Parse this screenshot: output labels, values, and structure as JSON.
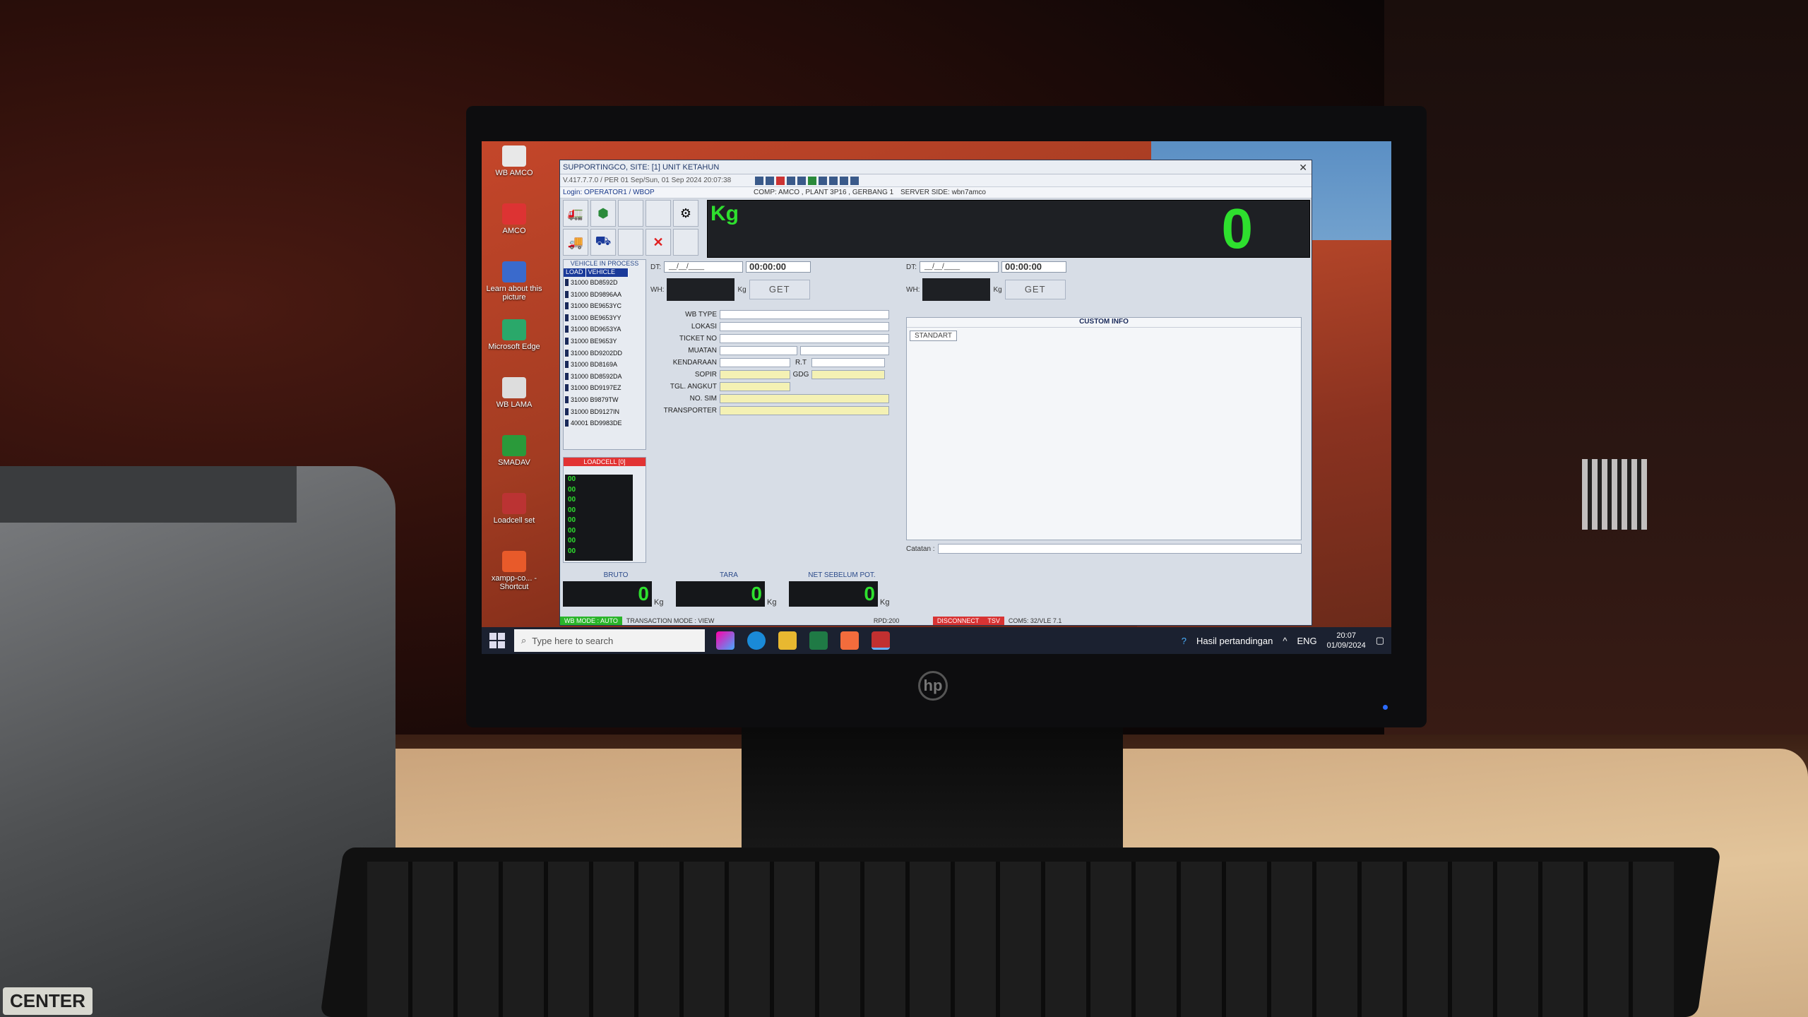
{
  "desktop_icons": [
    {
      "label": "WB AMCO",
      "color": "#e8e8e8"
    },
    {
      "label": "AMCO",
      "color": "#d33"
    },
    {
      "label": "Learn about this picture",
      "color": "#3a6acc"
    },
    {
      "label": "Microsoft Edge",
      "color": "#2aa86a"
    },
    {
      "label": "WB LAMA",
      "color": "#ddd"
    },
    {
      "label": "SMADAV",
      "color": "#2a9a3a"
    },
    {
      "label": "Loadcell set",
      "color": "#b33"
    },
    {
      "label": "xampp-co... - Shortcut",
      "color": "#e85a2a"
    }
  ],
  "window": {
    "title": "SUPPORTINGCO, SITE: [1] UNIT KETAHUN",
    "version": "V.417.7.7.0 / PER 01 Sep/Sun, 01 Sep 2024 20:07:38",
    "login": "Login: OPERATOR1 / WBOP",
    "comp": "COMP: AMCO , PLANT 3P16 , GERBANG 1",
    "server": "SERVER SIDE: wbn7amco"
  },
  "weigh": {
    "unit": "Kg",
    "value": "0"
  },
  "vehicle_panel": {
    "title": "VEHICLE IN PROCESS",
    "col_load": "LOAD",
    "col_vehicle": "VEHICLE",
    "vehicles": [
      "31000 BD8592D",
      "31000 BD9896AA",
      "31000 BE9653YC",
      "31000 BE9653YY",
      "31000 BD9653YA",
      "31000 BE9653Y",
      "31000 BD9202DD",
      "31000 BD8169A",
      "31000 BD8592DA",
      "31000 BD9197EZ",
      "31000 B9879TW",
      "31000 BD9127IN",
      "40001 BD9983DE"
    ]
  },
  "loadcell": {
    "title": "LOADCELL [0]",
    "values": [
      "00",
      "00",
      "00",
      "00",
      "00",
      "00",
      "00",
      "00"
    ]
  },
  "form_left": {
    "dt_label": "DT:",
    "date": "__/__/____",
    "time": "00:00:00",
    "wh_label": "WH:",
    "kg": "Kg",
    "get": "GET",
    "fields": [
      "WB TYPE",
      "LOKASI",
      "TICKET NO",
      "MUATAN",
      "KENDARAAN",
      "SOPIR",
      "TGL. ANGKUT",
      "NO. SIM",
      "TRANSPORTER"
    ],
    "rt": "R.T",
    "gdg": "GDG",
    "tgl_value": "__/__/____"
  },
  "form_right": {
    "dt_label": "DT:",
    "date": "__/__/____",
    "time": "00:00:00",
    "wh_label": "WH:",
    "kg": "Kg",
    "get": "GET",
    "custom_info": "CUSTOM INFO",
    "standart": "STANDART",
    "catatan": "Catatan :"
  },
  "totals": [
    {
      "label": "BRUTO",
      "value": "0",
      "unit": "Kg"
    },
    {
      "label": "TARA",
      "value": "0",
      "unit": "Kg"
    },
    {
      "label": "NET SEBELUM POT.",
      "value": "0",
      "unit": "Kg"
    }
  ],
  "status": {
    "wb_mode": "WB MODE : AUTO",
    "trans_mode": "TRANSACTION MODE : VIEW",
    "rpd": "RPD:200",
    "disc": "DISCONNECT",
    "tsv": "TSV",
    "com": "COM5: 32/VLE 7.1"
  },
  "taskbar": {
    "search_placeholder": "Type here to search",
    "notif": "Hasil pertandingan",
    "lang": "ENG",
    "time": "20:07",
    "date": "01/09/2024"
  },
  "brand": {
    "printer": "CENTER",
    "monitor": "hp"
  }
}
